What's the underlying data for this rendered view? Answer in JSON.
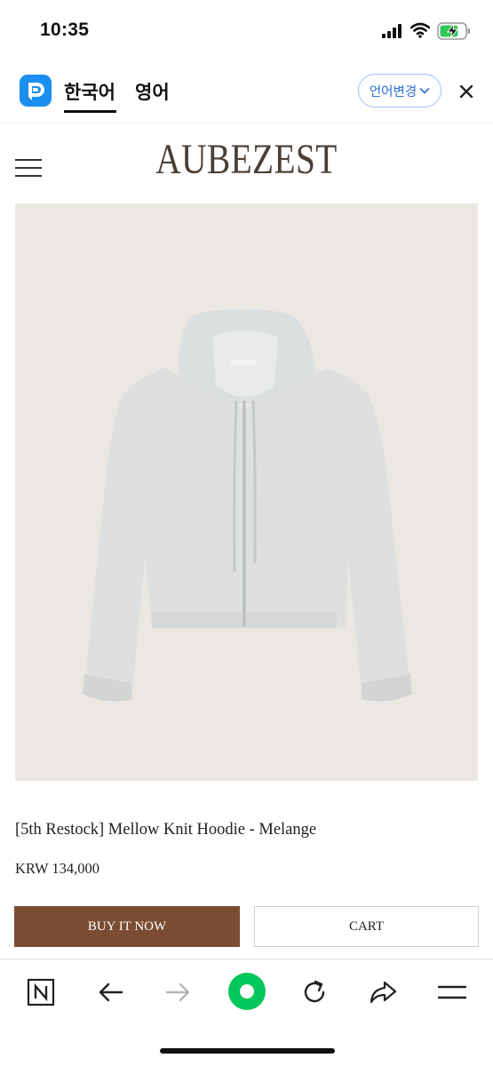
{
  "status_bar": {
    "time": "10:35",
    "icons": [
      "cellular-signal-icon",
      "wifi-icon",
      "battery-charging-icon"
    ]
  },
  "translate_bar": {
    "app_icon": "papago-logo-icon",
    "tabs": [
      {
        "label": "한국어",
        "active": true
      },
      {
        "label": "영어",
        "active": false
      }
    ],
    "language_button": "언어변경",
    "close_icon": "close-icon",
    "accent_color": "#1b8ef0"
  },
  "site_header": {
    "menu_icon": "hamburger-menu-icon",
    "logo": "AUBEZEST"
  },
  "product": {
    "image_desc": "light grey melange knit zip-up hoodie",
    "title": "[5th Restock] Mellow Knit Hoodie - Melange",
    "price": "KRW 134,000",
    "buy_label": "BUY IT NOW",
    "cart_label": "CART",
    "buy_color": "#7a4d33"
  },
  "bottom_toolbar": {
    "items": [
      "naver-n-icon",
      "back-arrow-icon",
      "forward-arrow-icon",
      "green-home-icon",
      "refresh-icon",
      "share-icon",
      "menu-icon"
    ],
    "green_color": "#03c75a"
  }
}
